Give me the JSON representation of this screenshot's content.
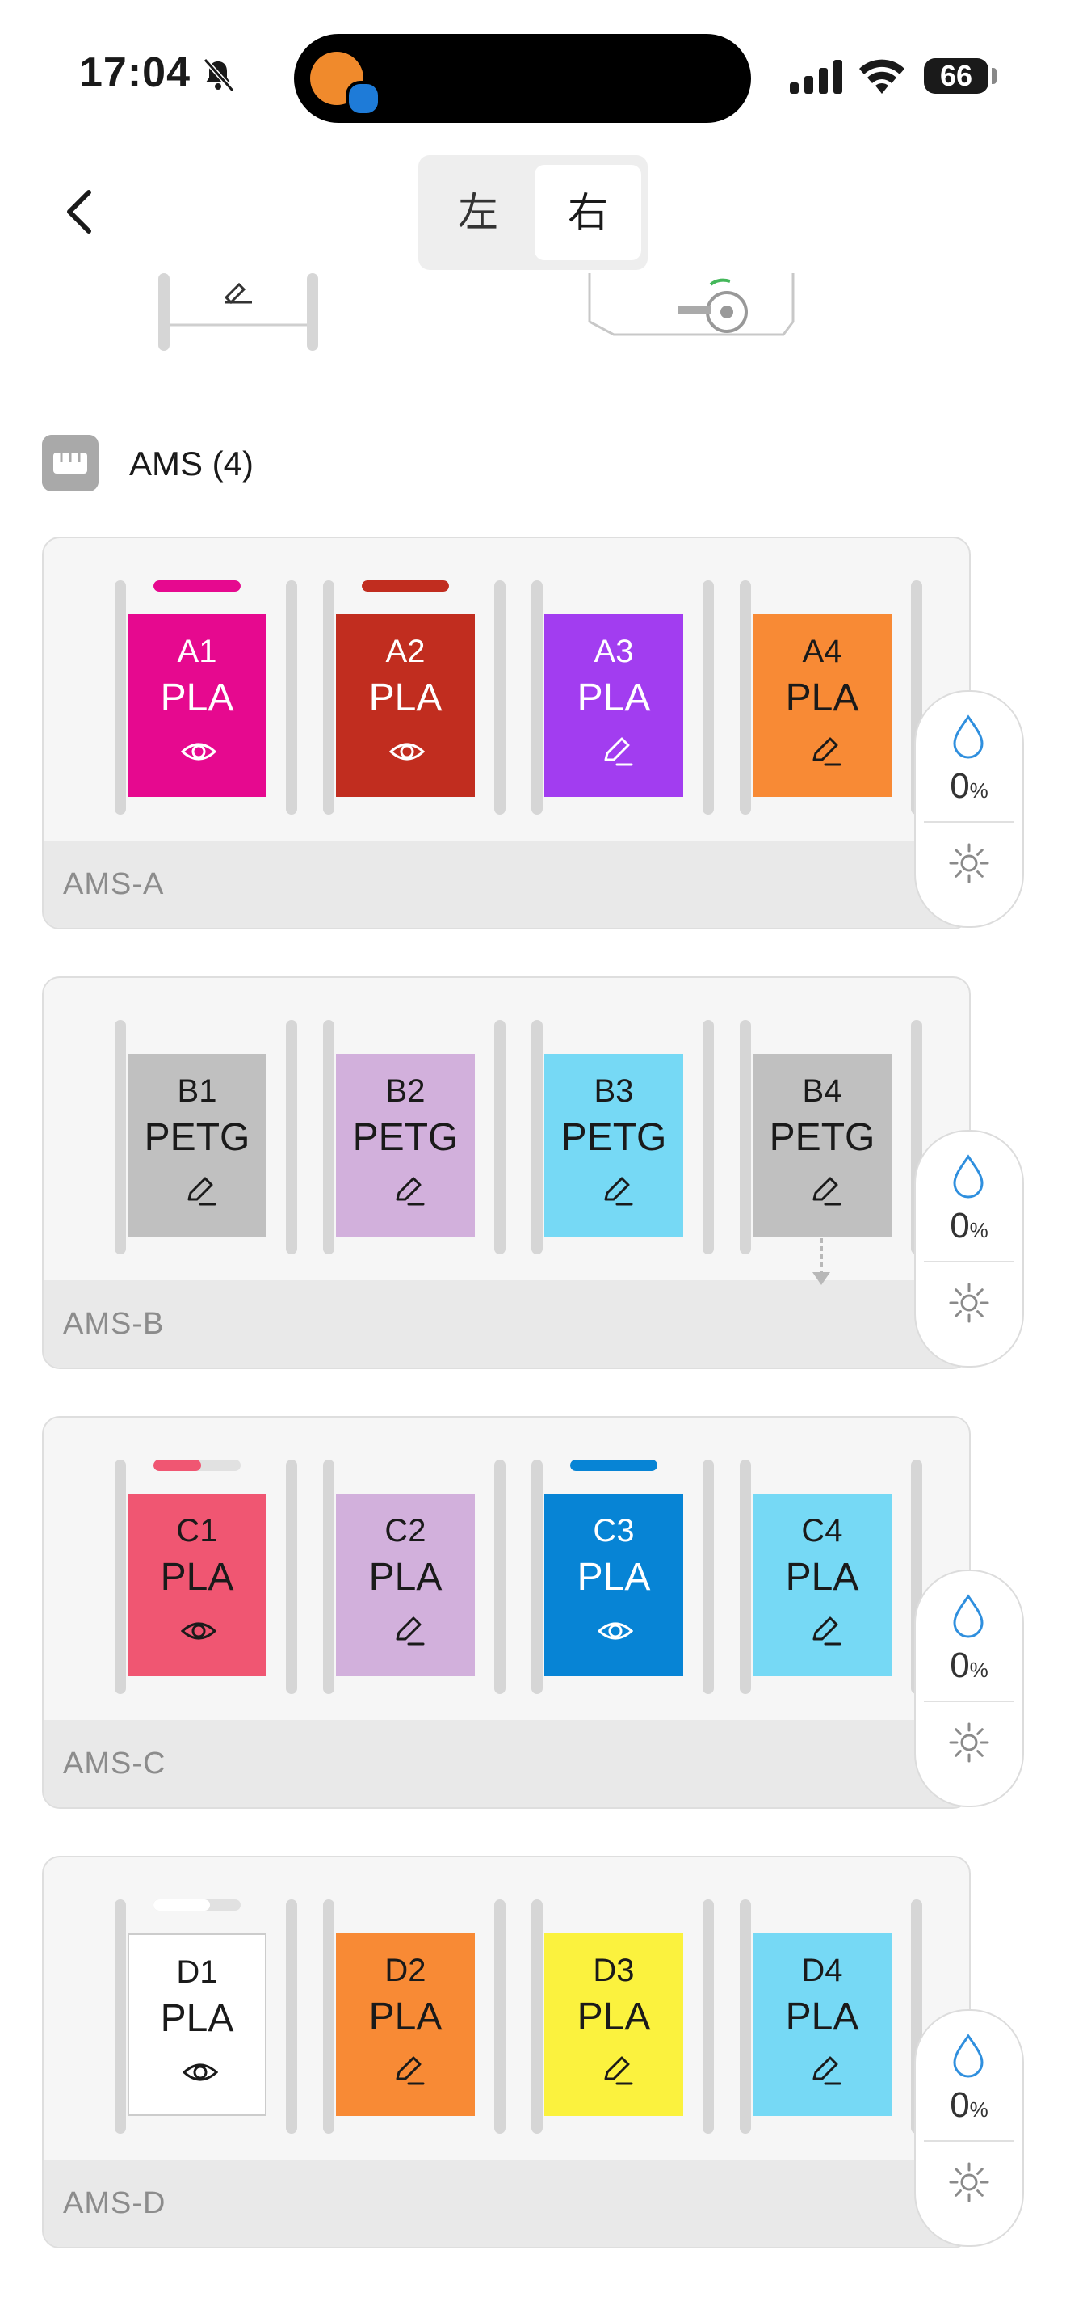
{
  "status_bar": {
    "time": "17:04",
    "battery": "66"
  },
  "nav": {
    "back_icon": "chevron-left-icon",
    "tabs": [
      "左",
      "右"
    ],
    "selected_tab": "右"
  },
  "ams": {
    "title": "AMS (4)"
  },
  "units": [
    {
      "label": "AMS-A",
      "humidity": "0",
      "humidity_unit": "%",
      "slots": [
        {
          "id": "A1",
          "material": "PLA",
          "color": "#e6098f",
          "text_color": "#ffffff",
          "icon": "eye-icon",
          "bar": 1.0,
          "bar_color": "#e6098f"
        },
        {
          "id": "A2",
          "material": "PLA",
          "color": "#c12d1f",
          "text_color": "#ffffff",
          "icon": "eye-icon",
          "bar": 1.0,
          "bar_color": "#c12d1f"
        },
        {
          "id": "A3",
          "material": "PLA",
          "color": "#a23df0",
          "text_color": "#ffffff",
          "icon": "pencil-icon"
        },
        {
          "id": "A4",
          "material": "PLA",
          "color": "#f88a35",
          "text_color": "#1a1a1a",
          "icon": "pencil-icon"
        }
      ]
    },
    {
      "label": "AMS-B",
      "humidity": "0",
      "humidity_unit": "%",
      "slots": [
        {
          "id": "B1",
          "material": "PETG",
          "color": "#c0c0c0",
          "text_color": "#1a1a1a",
          "icon": "pencil-icon"
        },
        {
          "id": "B2",
          "material": "PETG",
          "color": "#d2b0dc",
          "text_color": "#1a1a1a",
          "icon": "pencil-icon"
        },
        {
          "id": "B3",
          "material": "PETG",
          "color": "#76d9f5",
          "text_color": "#1a1a1a",
          "icon": "pencil-icon"
        },
        {
          "id": "B4",
          "material": "PETG",
          "color": "#c0c0c0",
          "text_color": "#1a1a1a",
          "icon": "pencil-icon",
          "feed_arrow": true
        }
      ]
    },
    {
      "label": "AMS-C",
      "humidity": "0",
      "humidity_unit": "%",
      "slots": [
        {
          "id": "C1",
          "material": "PLA",
          "color": "#f05672",
          "text_color": "#1a1a1a",
          "icon": "eye-icon",
          "bar": 0.55,
          "bar_color": "#f05672"
        },
        {
          "id": "C2",
          "material": "PLA",
          "color": "#d2b0dc",
          "text_color": "#1a1a1a",
          "icon": "pencil-icon"
        },
        {
          "id": "C3",
          "material": "PLA",
          "color": "#0784d5",
          "text_color": "#ffffff",
          "icon": "eye-icon",
          "bar": 1.0,
          "bar_color": "#0784d5"
        },
        {
          "id": "C4",
          "material": "PLA",
          "color": "#76d9f5",
          "text_color": "#1a1a1a",
          "icon": "pencil-icon"
        }
      ]
    },
    {
      "label": "AMS-D",
      "humidity": "0",
      "humidity_unit": "%",
      "slots": [
        {
          "id": "D1",
          "material": "PLA",
          "color": "#ffffff",
          "text_color": "#1a1a1a",
          "icon": "eye-icon",
          "bar": 0.65,
          "bar_color": "#ffffff"
        },
        {
          "id": "D2",
          "material": "PLA",
          "color": "#f88a35",
          "text_color": "#1a1a1a",
          "icon": "pencil-icon"
        },
        {
          "id": "D3",
          "material": "PLA",
          "color": "#fbf23e",
          "text_color": "#1a1a1a",
          "icon": "pencil-icon"
        },
        {
          "id": "D4",
          "material": "PLA",
          "color": "#76d9f5",
          "text_color": "#1a1a1a",
          "icon": "pencil-icon"
        }
      ]
    }
  ]
}
